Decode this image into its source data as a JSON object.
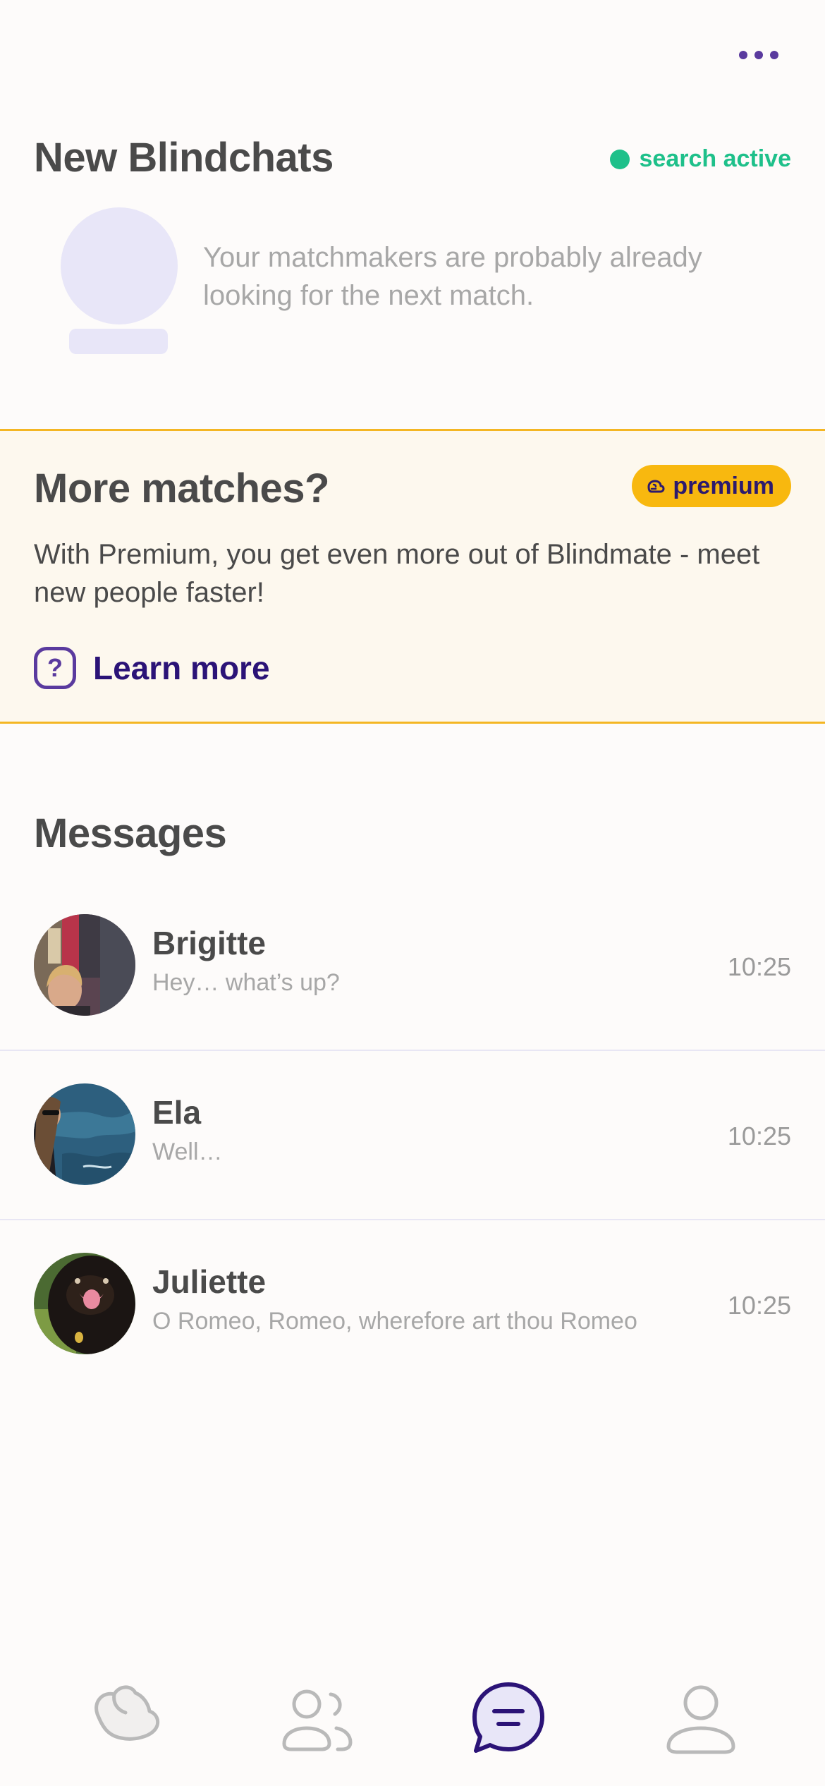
{
  "blindchats": {
    "title": "New Blindchats",
    "status_label": "search active",
    "empty_text": "Your matchmakers are probably already looking for the next match."
  },
  "premium": {
    "title": "More matches?",
    "badge_label": "premium",
    "description": "With Premium, you get even more out of Blindmate - meet new people faster!",
    "help_glyph": "?",
    "learn_more_label": "Learn more"
  },
  "messages": {
    "title": "Messages",
    "items": [
      {
        "name": "Brigitte",
        "preview": "Hey… what’s up?",
        "time": "10:25"
      },
      {
        "name": "Ela",
        "preview": "Well…",
        "time": "10:25"
      },
      {
        "name": "Juliette",
        "preview": "O Romeo, Romeo, wherefore art thou Romeo",
        "time": "10:25"
      }
    ]
  },
  "tabbar": {
    "tabs": [
      {
        "icon": "heart-icon",
        "active": false
      },
      {
        "icon": "people-icon",
        "active": false
      },
      {
        "icon": "chat-icon",
        "active": true
      },
      {
        "icon": "profile-icon",
        "active": false
      }
    ]
  },
  "colors": {
    "accent": "#2b1377",
    "accent_light": "#5a3a9e",
    "status_green": "#1ec08a",
    "premium_yellow": "#f8b80f",
    "premium_border": "#f4b623",
    "background": "#fdfbfa"
  }
}
